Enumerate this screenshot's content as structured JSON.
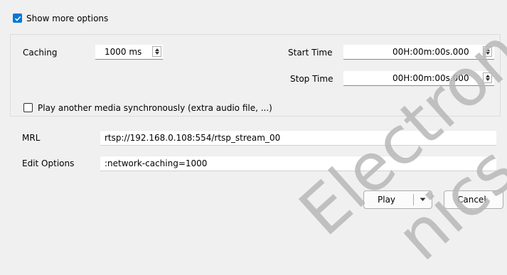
{
  "show_more_options": {
    "label": "Show more options",
    "checked": true
  },
  "caching": {
    "label": "Caching",
    "value": "1000 ms"
  },
  "start_time": {
    "label": "Start Time",
    "value": "00H:00m:00s.000"
  },
  "stop_time": {
    "label": "Stop Time",
    "value": "00H:00m:00s.000"
  },
  "play_another": {
    "label": "Play another media synchronously (extra audio file, ...)",
    "checked": false
  },
  "mrl": {
    "label": "MRL",
    "value": "rtsp://192.168.0.108:554/rtsp_stream_00"
  },
  "edit_options": {
    "label": "Edit Options",
    "value": ":network-caching=1000"
  },
  "buttons": {
    "play": "Play",
    "cancel": "Cancel"
  },
  "watermark": {
    "line1": "Electron",
    "line2": "nics"
  },
  "colors": {
    "accent": "#0078d7",
    "background": "#f0f0f0"
  }
}
